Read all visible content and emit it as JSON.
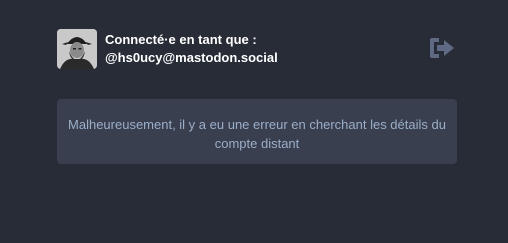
{
  "account": {
    "logged_in_label": "Connecté·e en tant que :",
    "handle": "@hs0ucy@mastodon.social",
    "avatar_icon": "user-avatar-portrait",
    "logout_icon": "sign-out-arrow-icon"
  },
  "error": {
    "message": "Malheureusement, il y a eu une erreur en cherchant les détails du compte distant"
  },
  "colors": {
    "background": "#282c37",
    "panel": "#393f4f",
    "text_primary": "#ffffff",
    "text_secondary": "#9baec8",
    "icon": "#606984"
  }
}
